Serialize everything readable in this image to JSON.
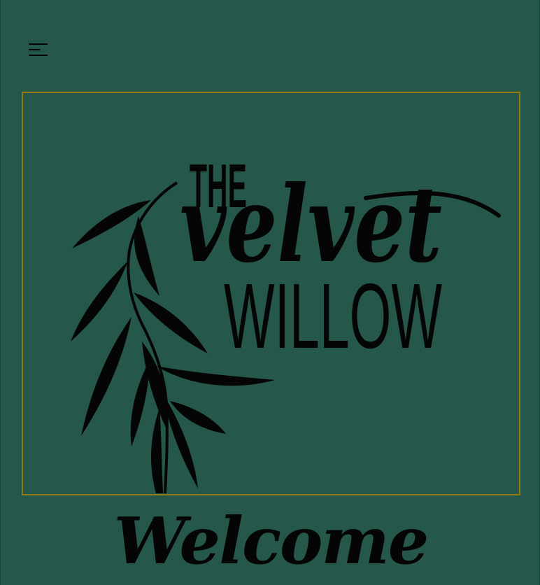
{
  "header": {
    "menu_icon": "hamburger-menu-icon"
  },
  "logo": {
    "prefix": "THE",
    "script_word": "velvet",
    "main_word": "WILLOW",
    "decoration_icon": "willow-branch-icon"
  },
  "welcome_heading": "Welcome",
  "colors": {
    "background": "#25574b",
    "frame_border": "#94790e",
    "ink": "#050505"
  }
}
